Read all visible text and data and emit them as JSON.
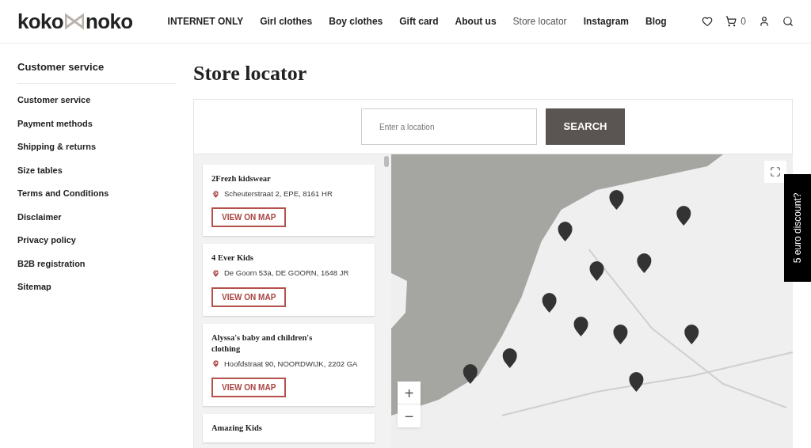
{
  "header": {
    "logo": {
      "left": "koko",
      "right": "noko"
    },
    "nav": [
      {
        "label": "INTERNET ONLY",
        "selected": false
      },
      {
        "label": "Girl clothes",
        "selected": false
      },
      {
        "label": "Boy clothes",
        "selected": false
      },
      {
        "label": "Gift card",
        "selected": false
      },
      {
        "label": "About us",
        "selected": false
      },
      {
        "label": "Store locator",
        "selected": true
      },
      {
        "label": "Instagram",
        "selected": false
      },
      {
        "label": "Blog",
        "selected": false
      }
    ],
    "cart_count": "0"
  },
  "sidebar": {
    "title": "Customer service",
    "items": [
      "Customer service",
      "Payment methods",
      "Shipping & returns",
      "Size tables",
      "Terms and Conditions",
      "Disclaimer",
      "Privacy policy",
      "B2B registration",
      "Sitemap"
    ]
  },
  "page_title": "Store locator",
  "search": {
    "placeholder": "Enter a location",
    "button": "SEARCH"
  },
  "stores": [
    {
      "name": "2Frezh kidswear",
      "address": "Scheuterstraat 2, EPE, 8161 HR",
      "button": "VIEW ON MAP"
    },
    {
      "name": "4 Ever Kids",
      "address": "De Goorn 53a, DE GOORN, 1648 JR",
      "button": "VIEW ON MAP"
    },
    {
      "name": "Alyssa's baby and children's clothing",
      "address": "Hoofdstraat 90, NOORDWIJK, 2202 GA",
      "button": "VIEW ON MAP"
    },
    {
      "name": "Amazing Kids"
    }
  ],
  "map": {
    "zoom_in": "+",
    "zoom_out": "−"
  },
  "discount_tab": "5 euro discount?"
}
